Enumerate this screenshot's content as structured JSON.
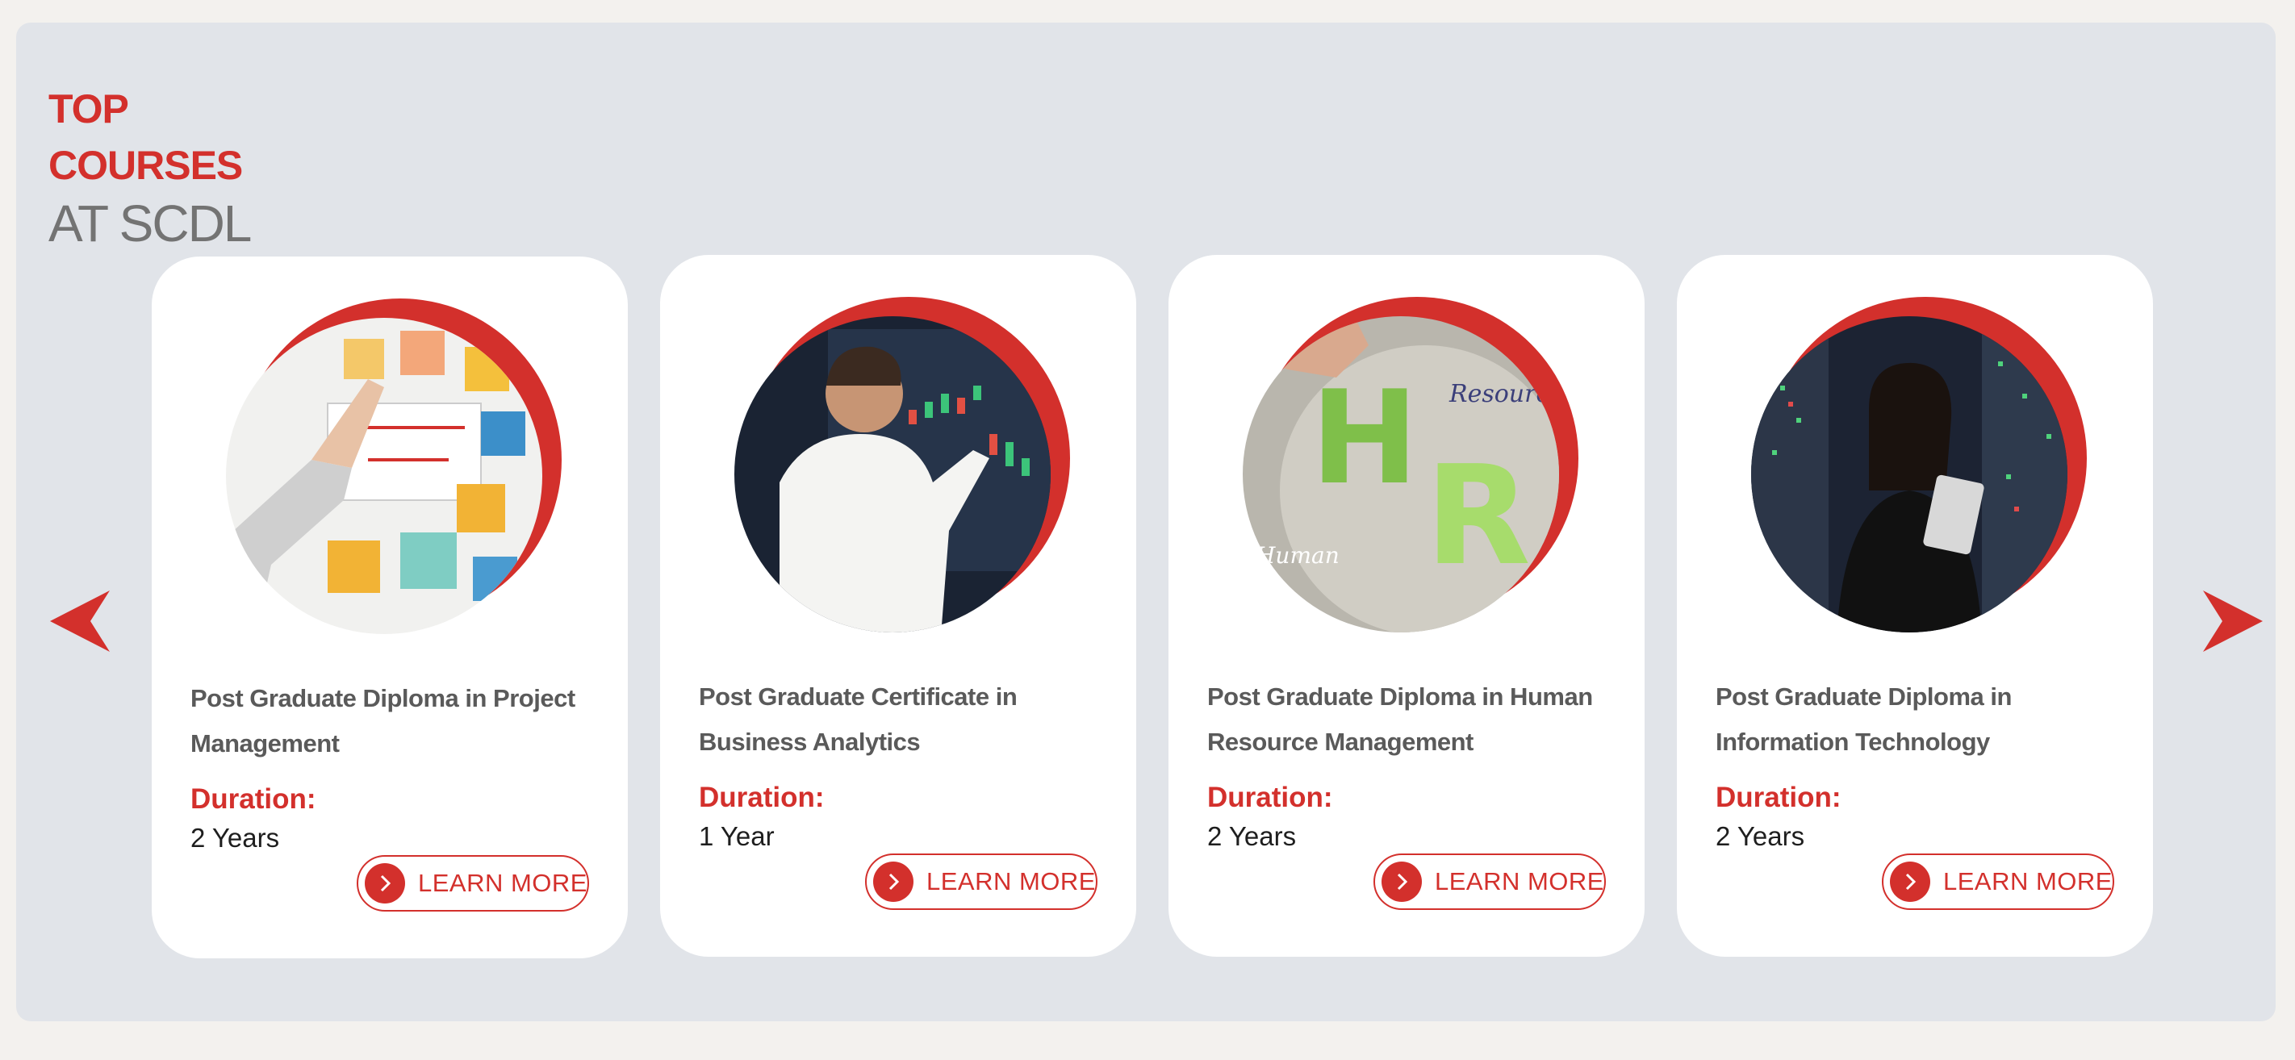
{
  "heading": {
    "line1": "TOP",
    "line2": "COURSES",
    "line3": "AT SCDL"
  },
  "colors": {
    "accent": "#d3302c",
    "panel_bg": "#e1e4e9",
    "card_bg": "#ffffff",
    "title_text": "#5a5a5a"
  },
  "carousel": {
    "prev_icon": "triangle-left-icon",
    "next_icon": "triangle-right-icon"
  },
  "courses": [
    {
      "title": "Post Graduate Diploma in Project Management",
      "duration_label": "Duration:",
      "duration_value": "2 Years",
      "cta": "LEARN MORE",
      "image": "person placing sticky notes on a project management board"
    },
    {
      "title": "Post Graduate Certificate in Business Analytics",
      "duration_label": "Duration:",
      "duration_value": "1 Year",
      "cta": "LEARN MORE",
      "image": "man pointing at a screen of charts"
    },
    {
      "title": "Post Graduate Diploma in Human Resource Management",
      "duration_label": "Duration:",
      "duration_value": "2 Years",
      "cta": "LEARN MORE",
      "image": "green letters H and R with handwritten words",
      "image_words": [
        "Resource",
        "Human"
      ],
      "image_letters": [
        "H",
        "R"
      ]
    },
    {
      "title": "Post Graduate Diploma in Information Technology",
      "duration_label": "Duration:",
      "duration_value": "2 Years",
      "cta": "LEARN MORE",
      "image": "woman holding a tablet in a server room"
    }
  ]
}
